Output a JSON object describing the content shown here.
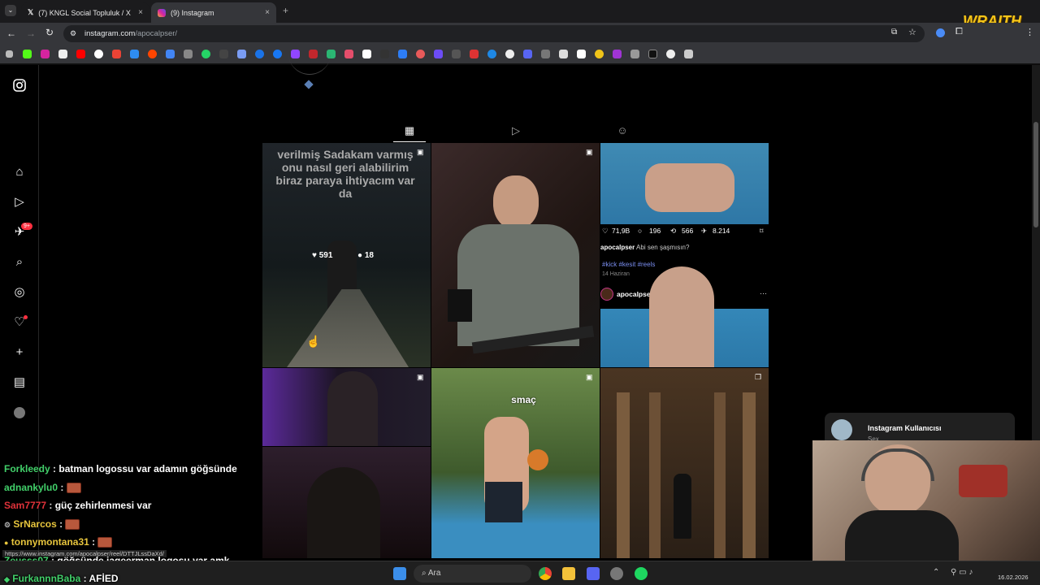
{
  "browser": {
    "tabs": [
      {
        "title": "(7) KNGL Social Topluluk / X",
        "active": false
      },
      {
        "title": "(9) Instagram",
        "active": true
      }
    ],
    "url_host": "instagram.com",
    "url_path": "/apocalpser/",
    "overlay_logo": "WRAITH"
  },
  "profile_tabs": [
    "posts-grid",
    "reels",
    "tagged"
  ],
  "notification_badge": "9+",
  "posts": [
    {
      "caption": "verilmiş Sadakam varmış onu nasıl geri alabilirim biraz paraya ihtiyacım var da",
      "likes": "591",
      "comments": "18"
    },
    {
      "likes": "71,9B",
      "comments": "196",
      "reposts": "566",
      "shares": "8.214",
      "username": "apocalpser",
      "text": "Abi sen şaşmısın?",
      "tags": "#kick #kesit #reels",
      "date": "14 Haziran",
      "author": "apocalpser"
    },
    {
      "caption": "smaç"
    }
  ],
  "notification": {
    "title": "Instagram Kullanıcısı",
    "sub": "Sex"
  },
  "status_url": "https://www.instagram.com/apocalpser/reel/DTTJLssDaXd/",
  "chat": [
    {
      "user": "Forkleedy",
      "color": "#42d06a",
      "message": "batman logossu var adamın göğsünde"
    },
    {
      "user": "adnankylu0",
      "color": "#42d06a",
      "message": ""
    },
    {
      "user": "Sam7777",
      "color": "#e0323a",
      "message": "güç zehirlenmesi var"
    },
    {
      "user": "SrNarcos",
      "color": "#e7c53d",
      "message": ""
    },
    {
      "user": "tonnymontana31",
      "color": "#e7c53d",
      "message": ""
    },
    {
      "user": "Zeusss07",
      "color": "#42d06a",
      "message": "göğsünde jageerman logosu var amk"
    },
    {
      "user": "FurkannnBaba",
      "color": "#42d06a",
      "message": "AFİED"
    }
  ],
  "taskbar": {
    "search_placeholder": "Ara",
    "date": "16.02.2026"
  }
}
